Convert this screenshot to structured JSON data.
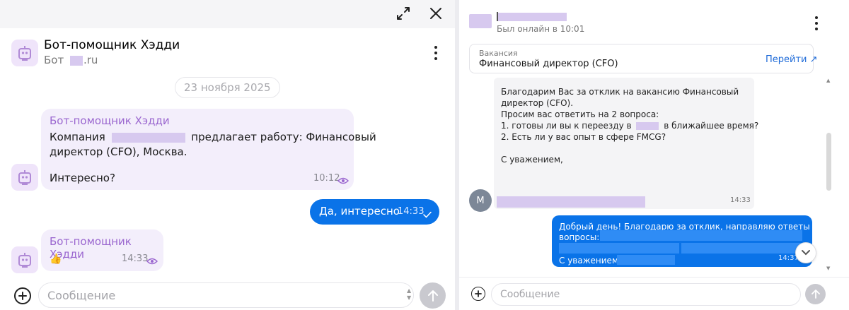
{
  "left": {
    "topbar": {
      "expand_icon": "expand-icon",
      "close_icon": "close-icon"
    },
    "header": {
      "title": "Бот-помощник Хэдди",
      "subtitle_prefix": "Бот",
      "subtitle_suffix": ".ru"
    },
    "date_separator": "23 ноября 2025",
    "messages": [
      {
        "sender": "Бот-помощник Хэдди",
        "text_prefix": "Компания",
        "text_line1_suffix": "предлагает работу: Финансовый",
        "text_line2": "директор (CFO), Москва.",
        "text_line3": "Интересно?",
        "time": "10:12",
        "status_icon": "eye-icon"
      },
      {
        "text": "Да, интересно",
        "time": "14:33",
        "status_icon": "check-icon"
      },
      {
        "sender": "Бот-помощник Хэдди",
        "emoji": "👍",
        "time": "14:33",
        "status_icon": "eye-icon"
      }
    ],
    "composer": {
      "placeholder": "Сообщение"
    }
  },
  "right": {
    "header": {
      "status": "Был онлайн в 10:01"
    },
    "vacancy": {
      "label": "Вакансия",
      "title": "Финансовый директор (CFO)",
      "link": "Перейти ↗"
    },
    "incoming": {
      "line1": "Благодарим Вас за отклик на вакансию Финансовый",
      "line2": "директор (CFO).",
      "line3": "Просим вас ответить на 2 вопроса:",
      "line4_prefix": "1. готовы ли вы к переезду в",
      "line4_suffix": "в ближайшее время?",
      "line5": "2. Есть ли у вас опыт в сфере FMCG?",
      "line6": "С уважением,",
      "time": "14:33",
      "avatar_letter": "М"
    },
    "outgoing": {
      "line1": "Добрый день! Благодарю за отклик, направляю ответы на",
      "line2": "вопросы:",
      "line3": "С уважением,",
      "time": "14:37"
    },
    "composer": {
      "placeholder": "Сообщение"
    }
  },
  "colors": {
    "accent_blue": "#0a73e8",
    "bot_purple": "#9a66cf",
    "bubble_lavender": "#f3eefb",
    "redaction": "#d7c9ef"
  }
}
